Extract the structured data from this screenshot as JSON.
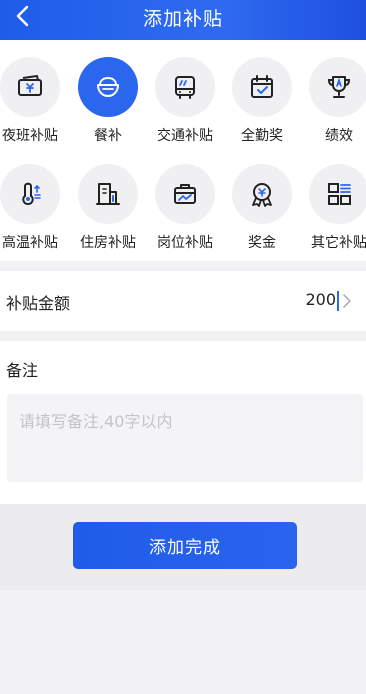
{
  "header": {
    "title": "添加补贴"
  },
  "categories": [
    {
      "label": "夜班补贴",
      "icon": "night-shift-ticket-icon",
      "active": false
    },
    {
      "label": "餐补",
      "icon": "meal-bowl-icon",
      "active": true
    },
    {
      "label": "交通补贴",
      "icon": "bus-icon",
      "active": false
    },
    {
      "label": "全勤奖",
      "icon": "calendar-check-icon",
      "active": false
    },
    {
      "label": "绩效",
      "icon": "trophy-icon",
      "active": false
    },
    {
      "label": "高温补贴",
      "icon": "thermometer-icon",
      "active": false
    },
    {
      "label": "住房补贴",
      "icon": "building-icon",
      "active": false
    },
    {
      "label": "岗位补贴",
      "icon": "briefcase-icon",
      "active": false
    },
    {
      "label": "奖金",
      "icon": "medal-icon",
      "active": false
    },
    {
      "label": "其它补贴",
      "icon": "grid-list-icon",
      "active": false
    }
  ],
  "amount": {
    "label": "补贴金额",
    "value": "200"
  },
  "remark": {
    "label": "备注",
    "placeholder": "请填写备注,40字以内",
    "value": ""
  },
  "submit": {
    "label": "添加完成"
  },
  "colors": {
    "accent": "#2b67ee",
    "icon_stroke": "#222222"
  }
}
